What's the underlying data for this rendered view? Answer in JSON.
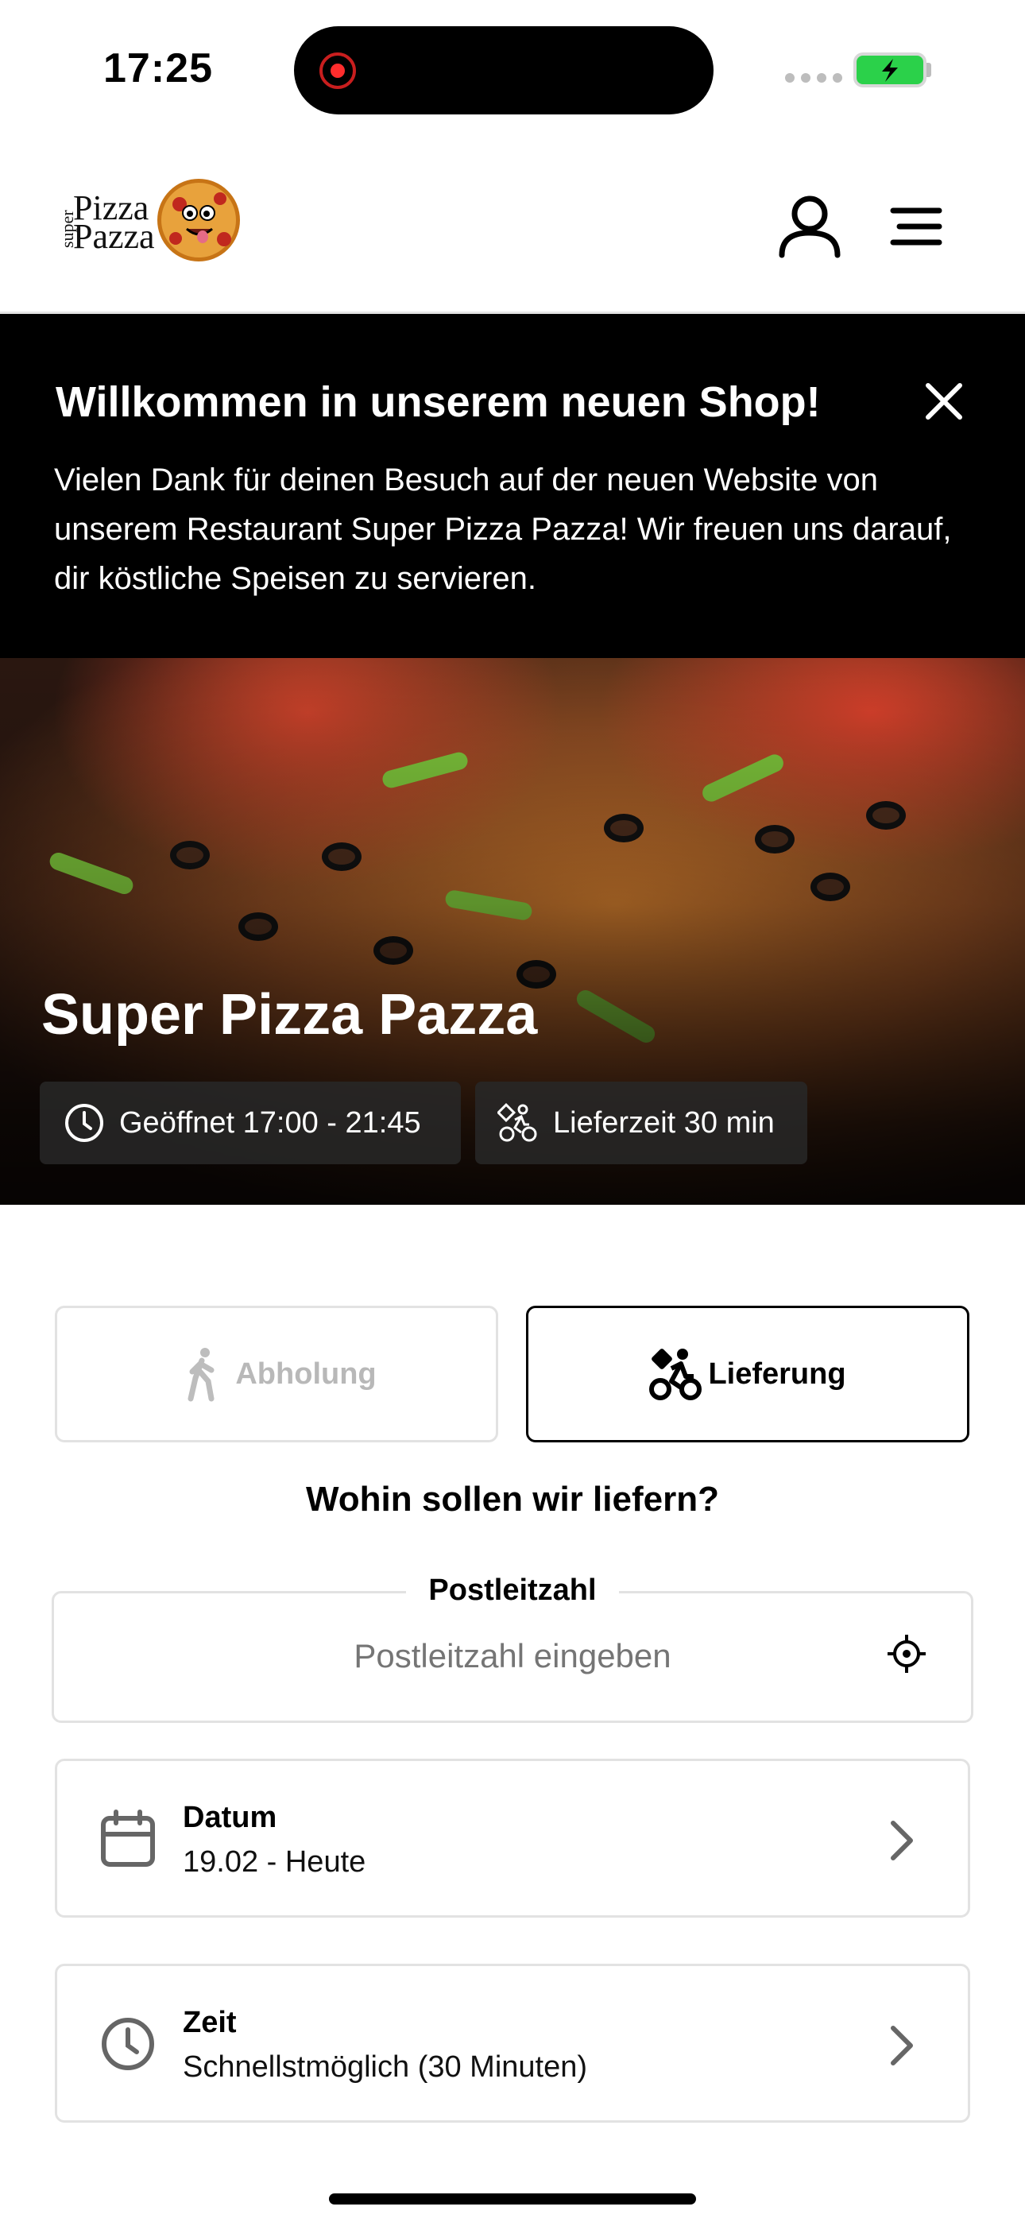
{
  "status_bar": {
    "time": "17:25"
  },
  "header": {
    "logo": {
      "super": "super",
      "pizza": "Pizza",
      "pazza": "Pazza"
    },
    "icons": [
      "user-icon",
      "hamburger-menu-icon"
    ]
  },
  "banner": {
    "title": "Willkommen in unserem neuen Shop!",
    "text": "Vielen Dank für deinen Besuch auf der neuen Website von unserem Restaurant Super Pizza Pazza! Wir freuen uns darauf, dir köstliche Speisen zu servieren.",
    "close_icon": "close-icon"
  },
  "hero": {
    "title": "Super Pizza Pazza",
    "opening": "Geöffnet 17:00 - 21:45",
    "delivery_time": "Lieferzeit 30 min"
  },
  "modes": {
    "pickup_label": "Abholung",
    "delivery_label": "Lieferung",
    "selected": "delivery"
  },
  "delivery": {
    "question": "Wohin sollen wir liefern?",
    "postal_label": "Postleitzahl",
    "postal_placeholder": "Postleitzahl eingeben",
    "postal_value": ""
  },
  "date": {
    "title": "Datum",
    "value": "19.02 - Heute"
  },
  "time": {
    "title": "Zeit",
    "value": "Schnellstmöglich (30 Minuten)"
  },
  "colors": {
    "battery": "#2bd14a",
    "record": "#ff2d2d",
    "banner_bg": "#000000",
    "border": "#e2e2e2"
  }
}
